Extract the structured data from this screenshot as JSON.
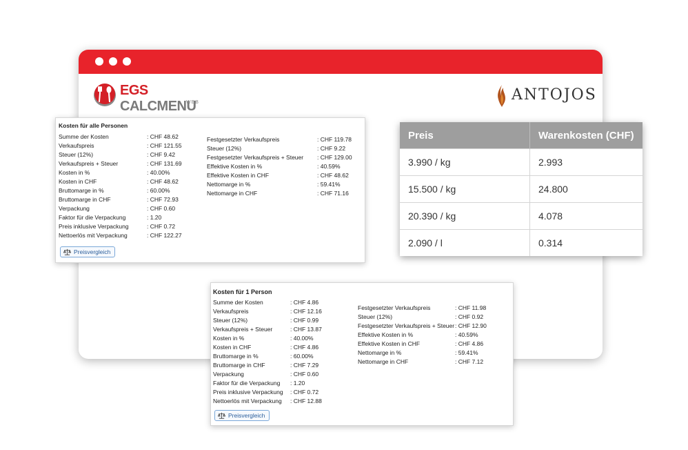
{
  "brand": {
    "egs_name_part1": "EGS",
    "egs_name_part2": "CALCMENU",
    "egs_sub": "WEB",
    "client_name": "ANTOJOS"
  },
  "colors": {
    "accent": "#e8232b",
    "table_header": "#9e9e9e",
    "button_border": "#7aa7d8"
  },
  "panel_all": {
    "title": "Kosten für alle Personen",
    "left": [
      {
        "label": "Summe der Kosten",
        "value": ": CHF 48.62"
      },
      {
        "label": "Verkaufspreis",
        "value": ": CHF 121.55"
      },
      {
        "label": "Steuer (12%)",
        "value": ": CHF 9.42"
      },
      {
        "label": "Verkaufspreis + Steuer",
        "value": ": CHF 131.69"
      },
      {
        "label": "Kosten in %",
        "value": ": 40.00%"
      },
      {
        "label": "Kosten in CHF",
        "value": ": CHF 48.62"
      },
      {
        "label": "Bruttomarge in %",
        "value": ": 60.00%"
      },
      {
        "label": "Bruttomarge in CHF",
        "value": ": CHF 72.93"
      },
      {
        "label": "Verpackung",
        "value": ": CHF 0.60"
      },
      {
        "label": "Faktor für die Verpackung",
        "value": ": 1.20"
      },
      {
        "label": "Preis inklusive Verpackung",
        "value": ": CHF 0.72"
      },
      {
        "label": "Nettoerlös mit Verpackung",
        "value": ": CHF 122.27"
      }
    ],
    "right": [
      {
        "label": "Festgesetzter Verkaufspreis",
        "value": ": CHF 119.78"
      },
      {
        "label": "Steuer (12%)",
        "value": ": CHF 9.22"
      },
      {
        "label": "Festgesetzter Verkaufspreis + Steuer",
        "value": ": CHF 129.00"
      },
      {
        "label": "Effektive Kosten in %",
        "value": ": 40.59%"
      },
      {
        "label": "Effektive Kosten in CHF",
        "value": ": CHF 48.62"
      },
      {
        "label": "Nettomarge in %",
        "value": ": 59.41%"
      },
      {
        "label": "Nettomarge in CHF",
        "value": ": CHF 71.16"
      }
    ],
    "button_label": "Preisvergleich"
  },
  "panel_one": {
    "title": "Kosten für 1 Person",
    "left": [
      {
        "label": "Summe der Kosten",
        "value": ": CHF 4.86"
      },
      {
        "label": "Verkaufspreis",
        "value": ": CHF 12.16"
      },
      {
        "label": "Steuer (12%)",
        "value": ": CHF 0.99"
      },
      {
        "label": "Verkaufspreis + Steuer",
        "value": ": CHF 13.87"
      },
      {
        "label": "Kosten in %",
        "value": ": 40.00%"
      },
      {
        "label": "Kosten in CHF",
        "value": ": CHF 4.86"
      },
      {
        "label": "Bruttomarge in %",
        "value": ": 60.00%"
      },
      {
        "label": "Bruttomarge in CHF",
        "value": ": CHF 7.29"
      },
      {
        "label": "Verpackung",
        "value": ": CHF 0.60"
      },
      {
        "label": "Faktor für die Verpackung",
        "value": ": 1.20"
      },
      {
        "label": "Preis inklusive Verpackung",
        "value": ": CHF 0.72"
      },
      {
        "label": "Nettoerlös mit Verpackung",
        "value": ": CHF 12.88"
      }
    ],
    "right": [
      {
        "label": "Festgesetzter Verkaufspreis",
        "value": ": CHF 11.98"
      },
      {
        "label": "Steuer (12%)",
        "value": ": CHF 0.92"
      },
      {
        "label": "Festgesetzter Verkaufspreis + Steuer",
        "value": ": CHF 12.90"
      },
      {
        "label": "Effektive Kosten in %",
        "value": ": 40.59%"
      },
      {
        "label": "Effektive Kosten in CHF",
        "value": ": CHF 4.86"
      },
      {
        "label": "Nettomarge in %",
        "value": ": 59.41%"
      },
      {
        "label": "Nettomarge in CHF",
        "value": ": CHF 7.12"
      }
    ],
    "button_label": "Preisvergleich"
  },
  "price_table": {
    "headers": [
      "Preis",
      "Warenkosten (CHF)"
    ],
    "rows": [
      [
        "3.990 / kg",
        "2.993"
      ],
      [
        "15.500 / kg",
        "24.800"
      ],
      [
        "20.390 / kg",
        "4.078"
      ],
      [
        "2.090 / l",
        "0.314"
      ]
    ]
  }
}
